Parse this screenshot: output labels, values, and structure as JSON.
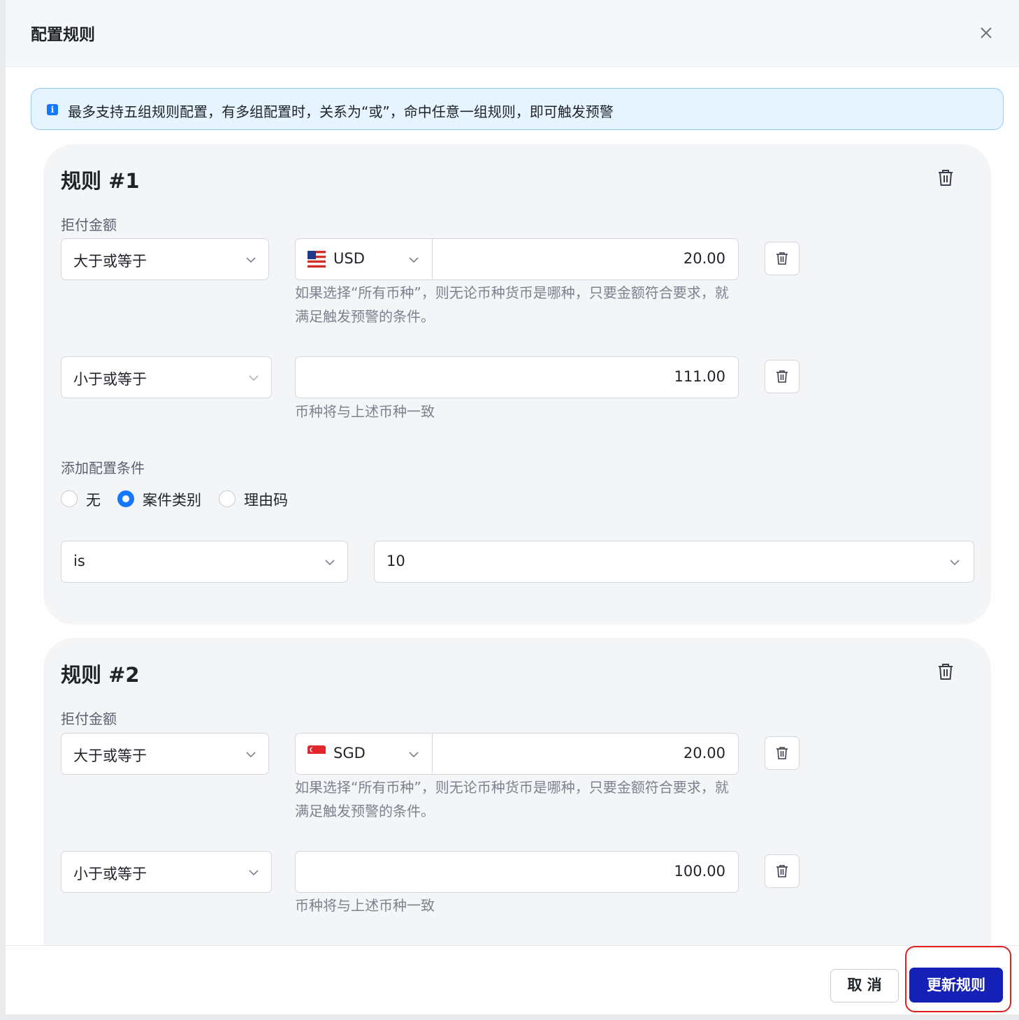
{
  "modal": {
    "title": "配置规则"
  },
  "info": {
    "text": "最多支持五组规则配置，有多组配置时，关系为“或”，命中任意一组规则，即可触发预警",
    "icon": "info-icon"
  },
  "rules": [
    {
      "title": "规则 #1",
      "amount_label": "拒付金额",
      "cond1": {
        "operator": "大于或等于",
        "currency": "USD",
        "flag": "us-flag",
        "amount": "20.00",
        "hint": "如果选择“所有币种”，则无论币种货币是哪种，只要金额符合要求，就满足触发预警的条件。"
      },
      "cond2": {
        "operator": "小于或等于",
        "amount": "111.00",
        "hint": "币种将与上述币种一致"
      },
      "extra_label": "添加配置条件",
      "radios": [
        {
          "label": "无",
          "checked": false
        },
        {
          "label": "案件类别",
          "checked": true
        },
        {
          "label": "理由码",
          "checked": false
        }
      ],
      "filter": {
        "operator": "is",
        "value": "10"
      }
    },
    {
      "title": "规则 #2",
      "amount_label": "拒付金额",
      "cond1": {
        "operator": "大于或等于",
        "currency": "SGD",
        "flag": "sg-flag",
        "amount": "20.00",
        "hint": "如果选择“所有币种”，则无论币种货币是哪种，只要金额符合要求，就满足触发预警的条件。"
      },
      "cond2": {
        "operator": "小于或等于",
        "amount": "100.00",
        "hint": "币种将与上述币种一致"
      }
    }
  ],
  "footer": {
    "cancel_label": "取 消",
    "update_label": "更新规则",
    "highlight_color": "#e02020"
  },
  "colors": {
    "primary": "#1521b6",
    "radio_accent": "#1677ff",
    "info_bg": "#e6f4ff"
  }
}
